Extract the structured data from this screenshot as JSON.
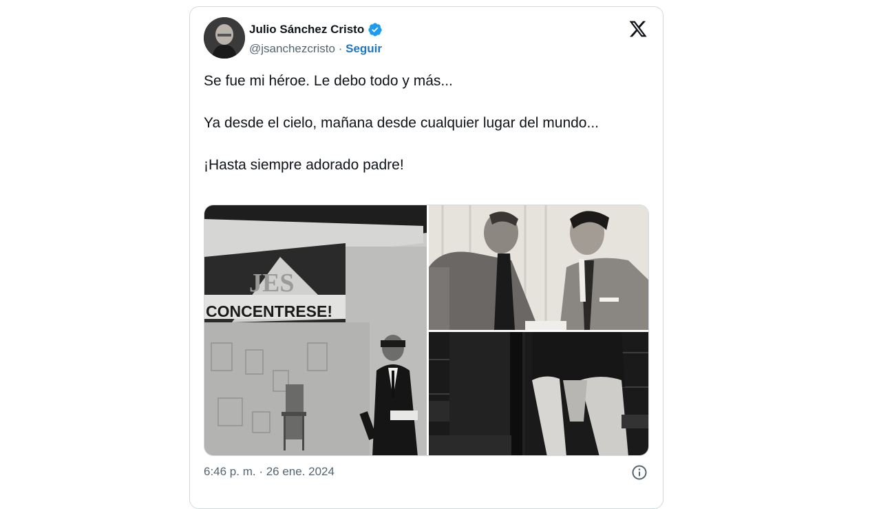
{
  "author": {
    "name": "Julio Sánchez Cristo",
    "handle": "@jsanchezcristo",
    "separator": "·",
    "follow_label": "Seguir",
    "verified_color": "#1d9bf0"
  },
  "tweet": {
    "paragraphs": [
      "Se fue mi héroe. Le debo todo y más...",
      "Ya desde el cielo, mañana desde cualquier lugar del mundo...",
      "¡Hasta siempre adorado padre!"
    ],
    "timestamp": "6:46 p. m. · 26 ene. 2024"
  },
  "media": {
    "photo1": {
      "sign_text": "CONCENTRESE!",
      "logo_text": "JES"
    }
  },
  "icons": {
    "platform": "x-logo-icon",
    "info": "info-icon",
    "verified": "verified-badge-icon"
  },
  "colors": {
    "text": "#0f1419",
    "secondary": "#536471",
    "link": "#1d76c6",
    "border": "#cfd9de"
  }
}
